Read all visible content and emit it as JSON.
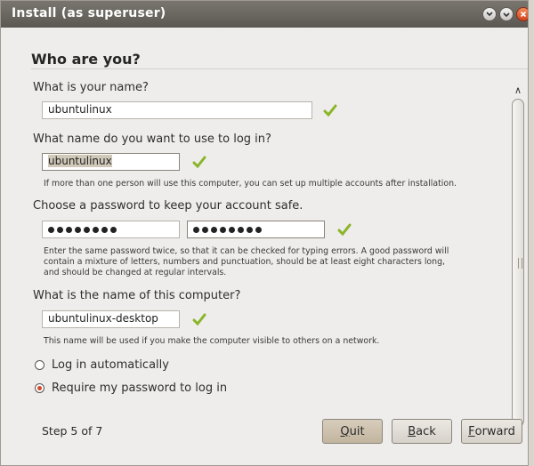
{
  "window": {
    "title": "Install (as superuser)",
    "title_bar_buttons": [
      "minimize-icon",
      "maximize-icon",
      "close-icon"
    ]
  },
  "page": {
    "heading": "Who are you?"
  },
  "name": {
    "question": "What is your name?",
    "value": "ubuntulinux"
  },
  "login": {
    "question": "What name do you want to use to log in?",
    "value": "ubuntulinux",
    "hint": "If more than one person will use this computer, you can set up multiple accounts after installation."
  },
  "password": {
    "question": "Choose a password to keep your account safe.",
    "mask_count": 8,
    "hint_line1": "Enter the same password twice, so that it can be checked for typing errors. A good password will",
    "hint_line2": "contain a mixture of letters, numbers and punctuation, should be at least eight characters long,",
    "hint_line3": "and should be changed at regular intervals."
  },
  "computer": {
    "question": "What is the name of this computer?",
    "value": "ubuntulinux-desktop",
    "hint": "This name will be used if you make the computer visible to others on a network."
  },
  "login_options": {
    "auto_label": "Log in automatically",
    "require_label": "Require my password to log in",
    "selected": "require"
  },
  "footer": {
    "step_label": "Step 5 of 7",
    "quit_first": "Q",
    "quit_rest": "uit",
    "back_first": "B",
    "back_rest": "ack",
    "forward_first": "F",
    "forward_rest": "orward"
  },
  "colors": {
    "check_green": "#8ab528",
    "title_bar": "#5b5852",
    "close_button": "#d5431c",
    "radio_selected": "#d4492a"
  }
}
